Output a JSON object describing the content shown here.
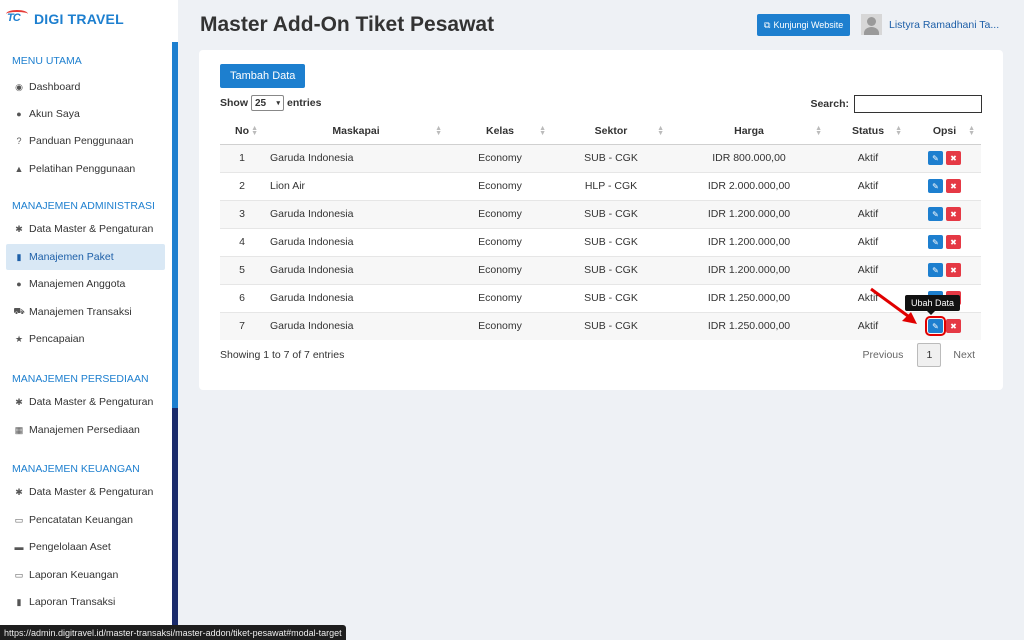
{
  "brand": {
    "logo_text": "TC",
    "name": "DIGI TRAVEL"
  },
  "sidebar": {
    "sections": [
      {
        "title": "MENU UTAMA",
        "items": [
          {
            "label": "Dashboard",
            "icon": "globe-icon",
            "glyph": "◉"
          },
          {
            "label": "Akun Saya",
            "icon": "user-icon",
            "glyph": "●"
          },
          {
            "label": "Panduan Penggunaan",
            "icon": "question-icon",
            "glyph": "?"
          },
          {
            "label": "Pelatihan Penggunaan",
            "icon": "graduation-cap-icon",
            "glyph": "▲"
          }
        ]
      },
      {
        "title": "MANAJEMEN ADMINISTRASI",
        "items": [
          {
            "label": "Data Master & Pengaturan",
            "icon": "cogs-icon",
            "glyph": "✱"
          },
          {
            "label": "Manajemen Paket",
            "icon": "book-icon",
            "glyph": "▮",
            "active": true
          },
          {
            "label": "Manajemen Anggota",
            "icon": "users-icon",
            "glyph": "●"
          },
          {
            "label": "Manajemen Transaksi",
            "icon": "cart-icon",
            "glyph": "⛟"
          },
          {
            "label": "Pencapaian",
            "icon": "star-icon",
            "glyph": "★"
          }
        ]
      },
      {
        "title": "MANAJEMEN PERSEDIAAN",
        "items": [
          {
            "label": "Data Master & Pengaturan",
            "icon": "cogs-icon",
            "glyph": "✱"
          },
          {
            "label": "Manajemen Persediaan",
            "icon": "cubes-icon",
            "glyph": "▦"
          }
        ]
      },
      {
        "title": "MANAJEMEN KEUANGAN",
        "items": [
          {
            "label": "Data Master & Pengaturan",
            "icon": "cogs-icon",
            "glyph": "✱"
          },
          {
            "label": "Pencatatan Keuangan",
            "icon": "money-icon",
            "glyph": "▭"
          },
          {
            "label": "Pengelolaan Aset",
            "icon": "hdd-icon",
            "glyph": "▬"
          },
          {
            "label": "Laporan Keuangan",
            "icon": "money-icon",
            "glyph": "▭"
          },
          {
            "label": "Laporan Transaksi",
            "icon": "book-icon",
            "glyph": "▮"
          }
        ]
      }
    ]
  },
  "header": {
    "title": "Master Add-On Tiket Pesawat",
    "visit_label": "Kunjungi Website",
    "user_name": "Listyra Ramadhani Ta..."
  },
  "card": {
    "add_label": "Tambah Data",
    "show_label": "Show",
    "show_value": "25",
    "entries_label": "entries",
    "search_label": "Search:",
    "search_value": "",
    "columns": [
      "No",
      "Maskapai",
      "Kelas",
      "Sektor",
      "Harga",
      "Status",
      "Opsi"
    ],
    "rows": [
      {
        "no": "1",
        "maskapai": "Garuda Indonesia",
        "kelas": "Economy",
        "sektor": "SUB - CGK",
        "harga": "IDR 800.000,00",
        "status": "Aktif"
      },
      {
        "no": "2",
        "maskapai": "Lion Air",
        "kelas": "Economy",
        "sektor": "HLP - CGK",
        "harga": "IDR 2.000.000,00",
        "status": "Aktif"
      },
      {
        "no": "3",
        "maskapai": "Garuda Indonesia",
        "kelas": "Economy",
        "sektor": "SUB - CGK",
        "harga": "IDR 1.200.000,00",
        "status": "Aktif"
      },
      {
        "no": "4",
        "maskapai": "Garuda Indonesia",
        "kelas": "Economy",
        "sektor": "SUB - CGK",
        "harga": "IDR 1.200.000,00",
        "status": "Aktif"
      },
      {
        "no": "5",
        "maskapai": "Garuda Indonesia",
        "kelas": "Economy",
        "sektor": "SUB - CGK",
        "harga": "IDR 1.200.000,00",
        "status": "Aktif"
      },
      {
        "no": "6",
        "maskapai": "Garuda Indonesia",
        "kelas": "Economy",
        "sektor": "SUB - CGK",
        "harga": "IDR 1.250.000,00",
        "status": "Aktif"
      },
      {
        "no": "7",
        "maskapai": "Garuda Indonesia",
        "kelas": "Economy",
        "sektor": "SUB - CGK",
        "harga": "IDR 1.250.000,00",
        "status": "Aktif"
      }
    ],
    "info": "Showing 1 to 7 of 7 entries",
    "prev_label": "Previous",
    "current_page": "1",
    "next_label": "Next"
  },
  "tooltip": "Ubah Data",
  "status_url": "https://admin.digitravel.id/master-transaksi/master-addon/tiket-pesawat#modal-target",
  "colors": {
    "primary": "#1d7fcf",
    "danger": "#e53945",
    "highlight": "#e00000"
  }
}
